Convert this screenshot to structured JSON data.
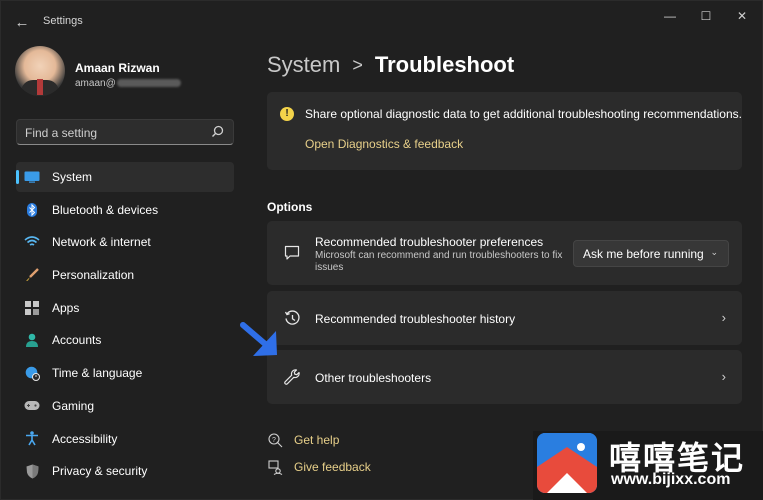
{
  "app": {
    "title": "Settings"
  },
  "window_controls": {
    "minimize": "—",
    "maximize": "☐",
    "close": "✕"
  },
  "profile": {
    "name": "Amaan Rizwan",
    "email_visible": "amaan@"
  },
  "search": {
    "placeholder": "Find a setting"
  },
  "sidebar": {
    "items": [
      {
        "label": "System",
        "icon": "monitor-icon",
        "active": true
      },
      {
        "label": "Bluetooth & devices",
        "icon": "bluetooth-icon",
        "active": false
      },
      {
        "label": "Network & internet",
        "icon": "wifi-icon",
        "active": false
      },
      {
        "label": "Personalization",
        "icon": "paintbrush-icon",
        "active": false
      },
      {
        "label": "Apps",
        "icon": "apps-icon",
        "active": false
      },
      {
        "label": "Accounts",
        "icon": "person-icon",
        "active": false
      },
      {
        "label": "Time & language",
        "icon": "globe-clock-icon",
        "active": false
      },
      {
        "label": "Gaming",
        "icon": "gamepad-icon",
        "active": false
      },
      {
        "label": "Accessibility",
        "icon": "accessibility-icon",
        "active": false
      },
      {
        "label": "Privacy & security",
        "icon": "shield-icon",
        "active": false
      }
    ]
  },
  "breadcrumb": {
    "parent": "System",
    "separator": ">",
    "current": "Troubleshoot"
  },
  "info": {
    "text": "Share optional diagnostic data to get additional troubleshooting recommendations.",
    "link": "Open Diagnostics & feedback"
  },
  "options": {
    "title": "Options",
    "preferences": {
      "title": "Recommended troubleshooter preferences",
      "description": "Microsoft can recommend and run troubleshooters to fix issues",
      "dropdown_value": "Ask me before running"
    },
    "history": {
      "title": "Recommended troubleshooter history"
    },
    "other": {
      "title": "Other troubleshooters"
    }
  },
  "help": {
    "get_help": "Get help",
    "give_feedback": "Give feedback"
  },
  "watermark": {
    "text": "嘻嘻笔记",
    "url": "www.bijixx.com"
  },
  "colors": {
    "accent": "#4cc2ff",
    "link": "#e8d08a",
    "info_icon": "#f3d34a",
    "annotation_arrow": "#2f6fe8",
    "background": "#202020",
    "card": "#2b2b2b"
  }
}
